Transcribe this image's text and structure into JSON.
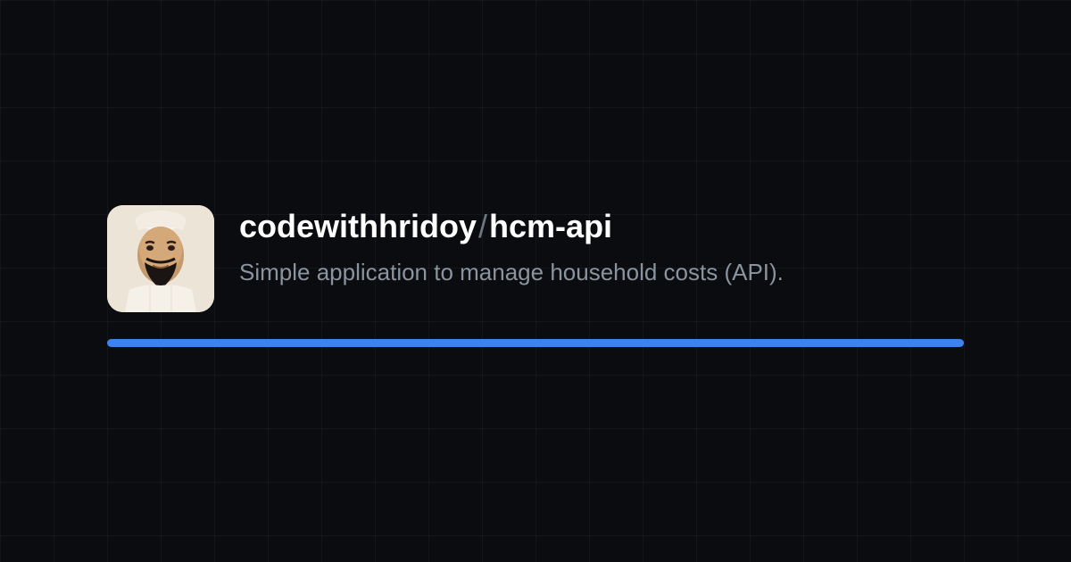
{
  "repo": {
    "owner": "codewithhridoy",
    "separator": "/",
    "name": "hcm-api",
    "description": "Simple application to manage household costs (API)."
  },
  "colors": {
    "accent": "#3d82f1",
    "background": "#0a0c10"
  },
  "avatar": {
    "alt": "user-avatar"
  }
}
